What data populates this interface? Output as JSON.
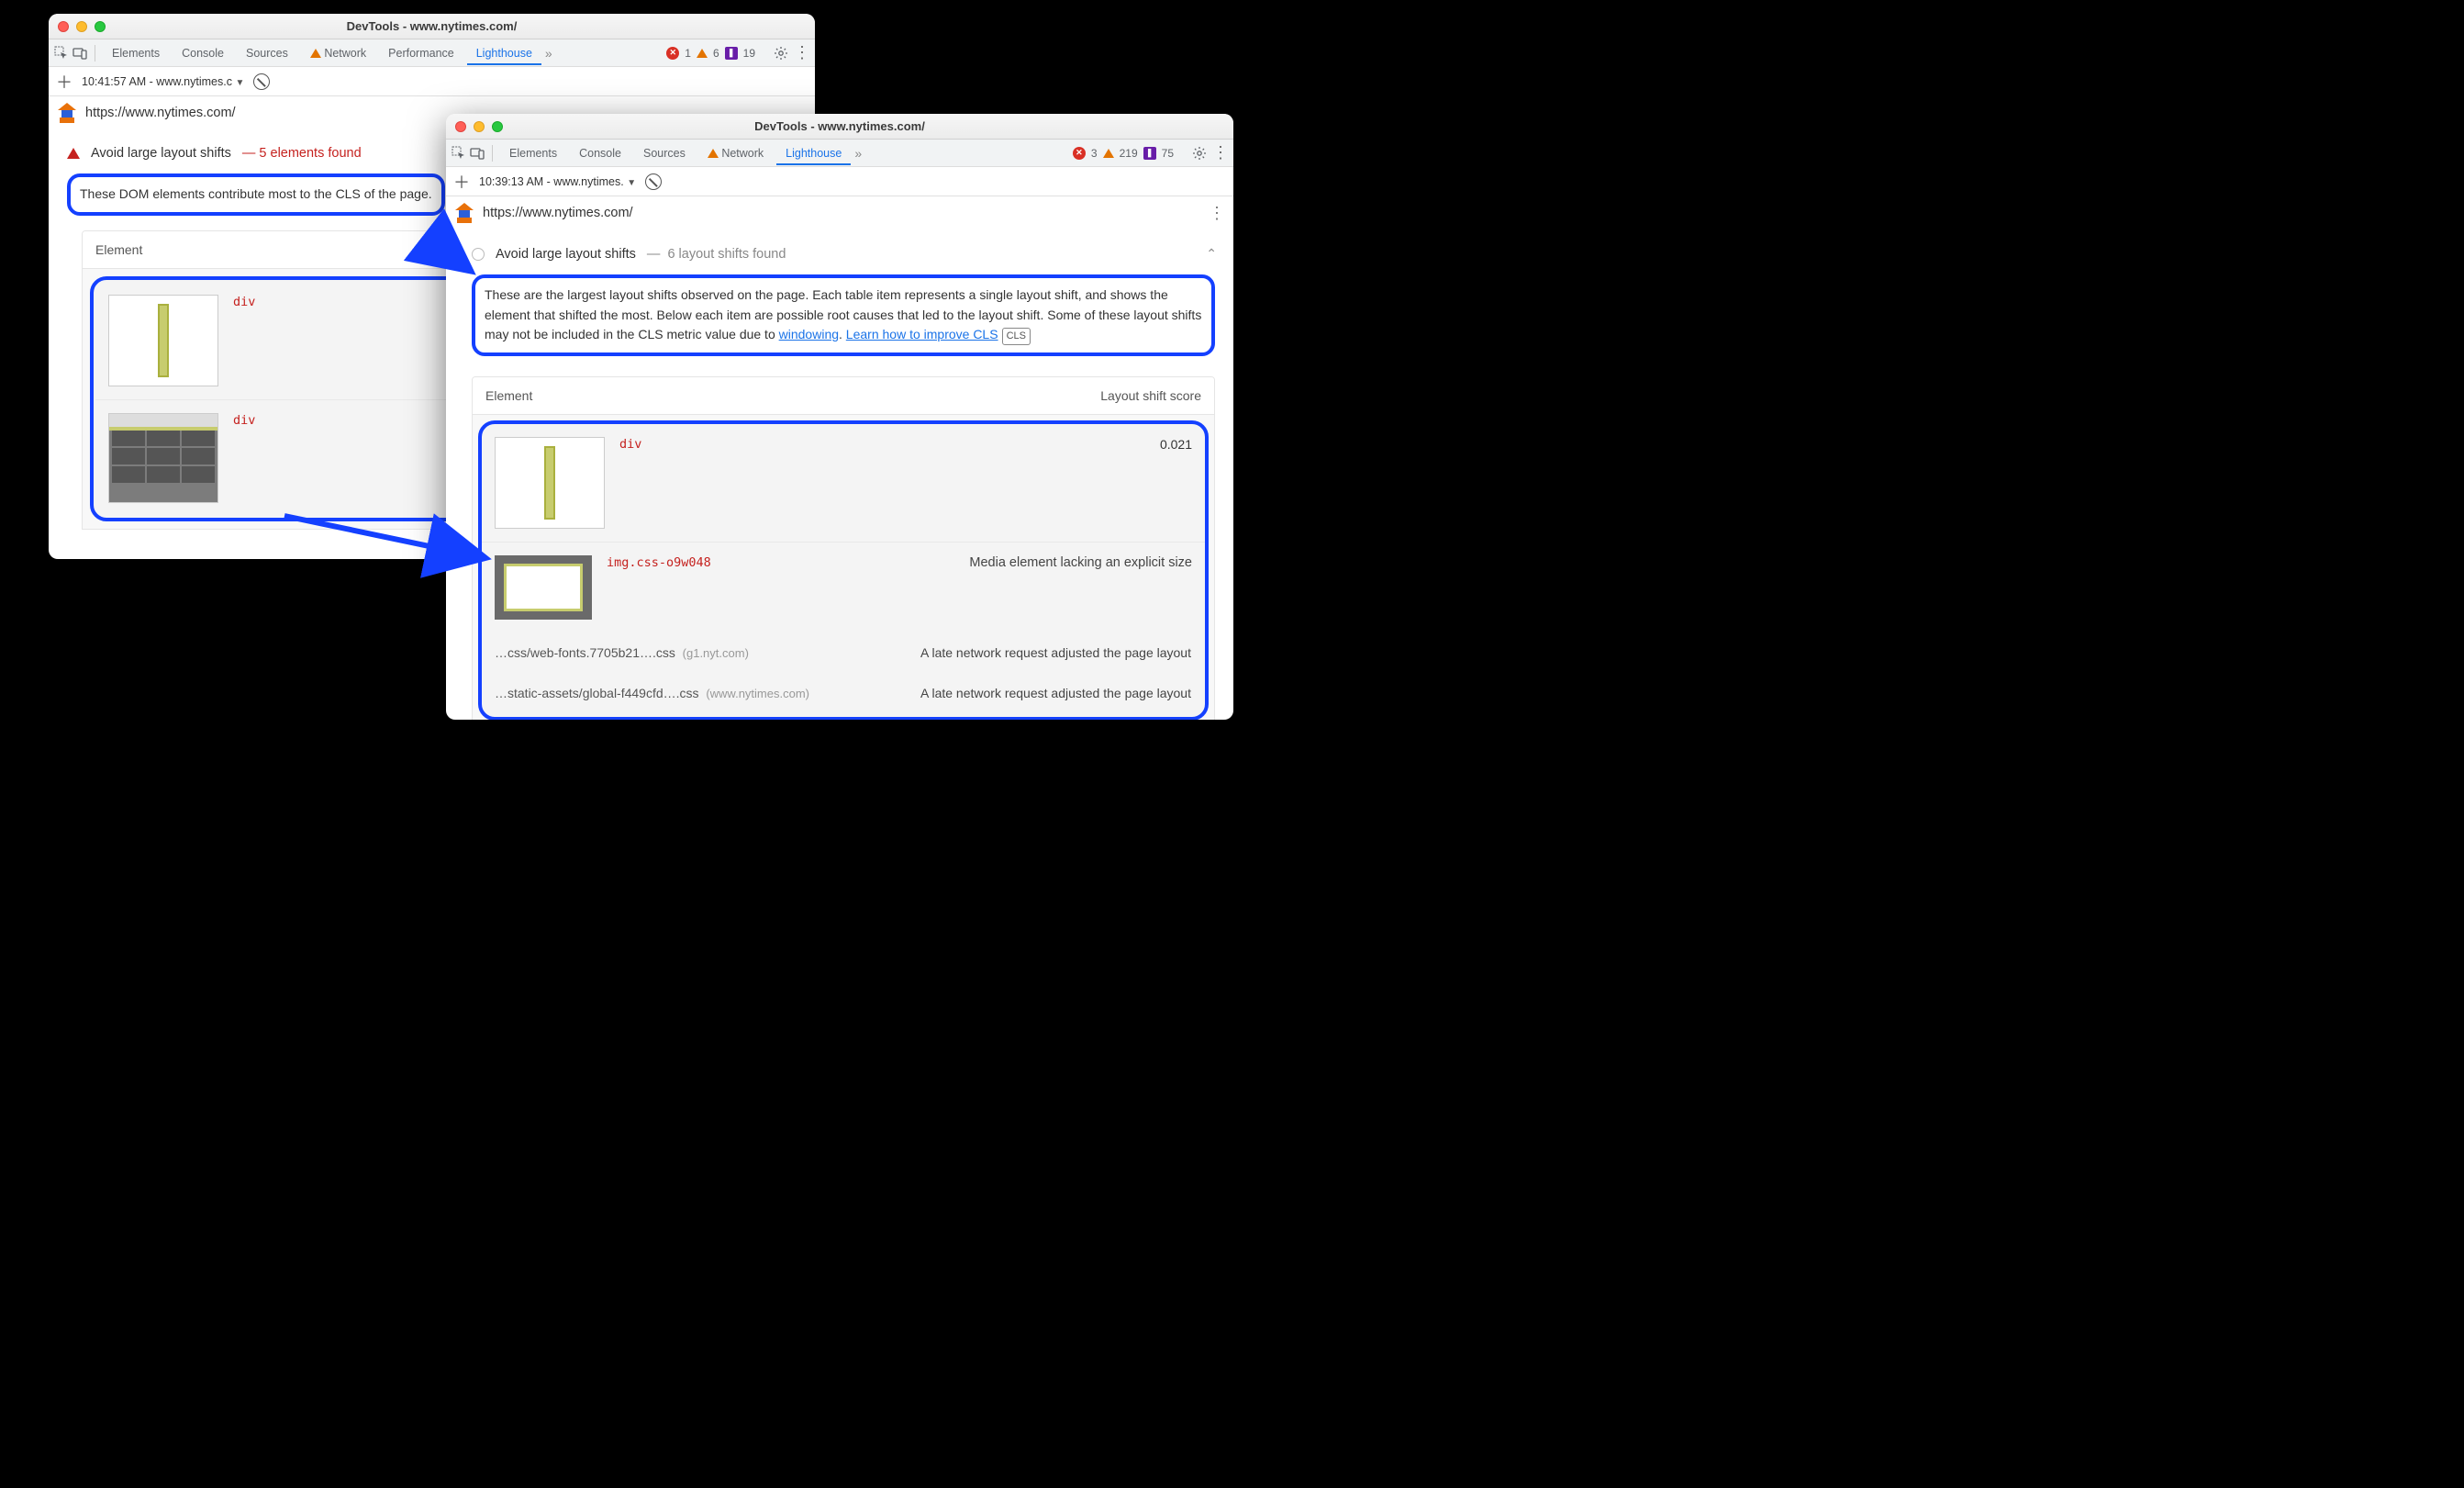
{
  "left": {
    "title": "DevTools - www.nytimes.com/",
    "tabs": [
      "Elements",
      "Console",
      "Sources",
      "Network",
      "Performance",
      "Lighthouse"
    ],
    "active_tab": "Lighthouse",
    "issues": {
      "errors": 1,
      "warnings": 6,
      "violations": 19
    },
    "report_label": "10:41:57 AM - www.nytimes.c",
    "url": "https://www.nytimes.com/",
    "audit_title": "Avoid large layout shifts",
    "audit_count": "5 elements found",
    "desc": "These DOM elements contribute most to the CLS of the page.",
    "col_element": "Element",
    "rows": [
      {
        "code": "div"
      },
      {
        "code": "div"
      }
    ]
  },
  "right": {
    "title": "DevTools - www.nytimes.com/",
    "tabs": [
      "Elements",
      "Console",
      "Sources",
      "Network",
      "Lighthouse"
    ],
    "active_tab": "Lighthouse",
    "issues": {
      "errors": 3,
      "warnings": 219,
      "violations": 75
    },
    "report_label": "10:39:13 AM - www.nytimes.",
    "url": "https://www.nytimes.com/",
    "audit_title": "Avoid large layout shifts",
    "audit_count": "6 layout shifts found",
    "desc_a": "These are the largest layout shifts observed on the page. Each table item represents a single layout shift, and shows the element that shifted the most. Below each item are possible root causes that led to the layout shift. Some of these layout shifts may not be included in the CLS metric value due to ",
    "link_windowing": "windowing",
    "link_learn": "Learn how to improve CLS",
    "cls_badge": "CLS",
    "col_element": "Element",
    "col_score": "Layout shift score",
    "row1": {
      "code": "div",
      "score": "0.021"
    },
    "row2": {
      "code": "img.css-o9w048",
      "reason": "Media element lacking an explicit size"
    },
    "cause1": {
      "file": "…css/web-fonts.7705b21….css",
      "origin": "(g1.nyt.com)",
      "reason": "A late network request adjusted the page layout"
    },
    "cause2": {
      "file": "…static-assets/global-f449cfd….css",
      "origin": "(www.nytimes.com)",
      "reason": "A late network request adjusted the page layout"
    }
  }
}
